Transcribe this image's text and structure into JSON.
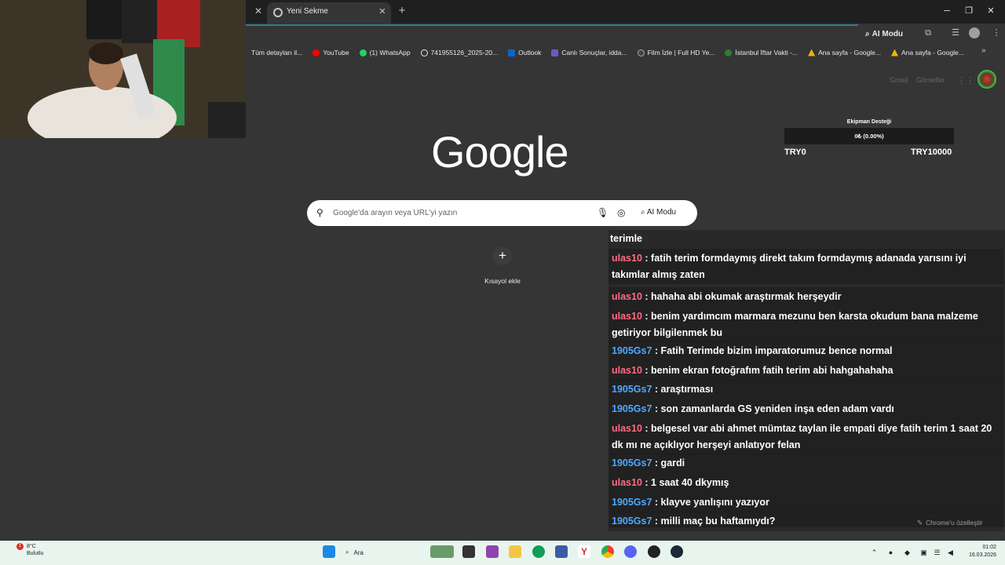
{
  "tab": {
    "title": "Yeni Sekme"
  },
  "toolbar": {
    "ai_mode_label": "AI Modu"
  },
  "bookmarks": [
    {
      "label": "Tüm detayları il...",
      "color": "#ffffff"
    },
    {
      "label": "YouTube",
      "color": "#ff0000"
    },
    {
      "label": "(1) WhatsApp",
      "color": "#25d366"
    },
    {
      "label": "741955126_2025-20...",
      "color": "#e8eaed"
    },
    {
      "label": "Outlook",
      "color": "#0a66c2"
    },
    {
      "label": "Canlı Sonuçlar, idda...",
      "color": "#6a5acd"
    },
    {
      "label": "Film İzle | Full HD Ye...",
      "color": "#444444"
    },
    {
      "label": "İstanbul İftar Vakti -...",
      "color": "#2e7d32"
    },
    {
      "label": "Ana sayfa - Google...",
      "color": "#f4b400"
    },
    {
      "label": "Ana sayfa - Google...",
      "color": "#f4b400"
    }
  ],
  "google": {
    "gmail": "Gmail",
    "images": "Görseller",
    "logo": "Google",
    "search_placeholder": "Google'da arayın veya URL'yi yazın",
    "ai_mode_label": "AI Modu",
    "add_shortcut": "Kısayol ekle",
    "customize": "Chrome'u özelleştir"
  },
  "donation": {
    "title": "Ekipman Desteği",
    "progress_text": "0₺ (0.00%)",
    "progress": 0,
    "min": "TRY0",
    "max": "TRY10000"
  },
  "chat": {
    "header": "terimle",
    "colors": {
      "ulas10": "#ff6b81",
      "1905Gs7": "#4fa8ff"
    },
    "messages": [
      {
        "user": "ulas10",
        "text": ": fatih terim formdaymış direkt takım formdaymış adanada yarısını iyi takımlar almış zaten"
      },
      {
        "user": "ulas10",
        "text": ": hahaha abi okumak araştırmak herşeydir"
      },
      {
        "user": "ulas10",
        "text": ": benim yardımcım marmara mezunu ben karsta okudum bana malzeme getiriyor bilgilenmek bu"
      },
      {
        "user": "1905Gs7",
        "text": ": Fatih Terimde bizim imparatorumuz bence normal"
      },
      {
        "user": "ulas10",
        "text": ": benim ekran fotoğrafım fatih terim abi hahgahahaha"
      },
      {
        "user": "1905Gs7",
        "text": ": araştırması"
      },
      {
        "user": "1905Gs7",
        "text": ": son zamanlarda GS yeniden inşa eden adam vardı"
      },
      {
        "user": "ulas10",
        "text": ": belgesel var abi ahmet mümtaz taylan ile empati diye fatih terim 1 saat 20 dk mı ne açıklıyor herşeyi anlatıyor felan"
      },
      {
        "user": "1905Gs7",
        "text": ": gardi"
      },
      {
        "user": "ulas10",
        "text": ": 1 saat 40 dkymış"
      },
      {
        "user": "1905Gs7",
        "text": ": klayve yanlışını yazıyor"
      },
      {
        "user": "1905Gs7",
        "text": ": milli maç bu haftamıydı?"
      }
    ]
  },
  "taskbar": {
    "weather_temp": "8°C",
    "weather_desc": "Bulutlu",
    "weather_badge": "1",
    "search_label": "Ara",
    "time": "01:02",
    "date": "16.03.2026"
  }
}
